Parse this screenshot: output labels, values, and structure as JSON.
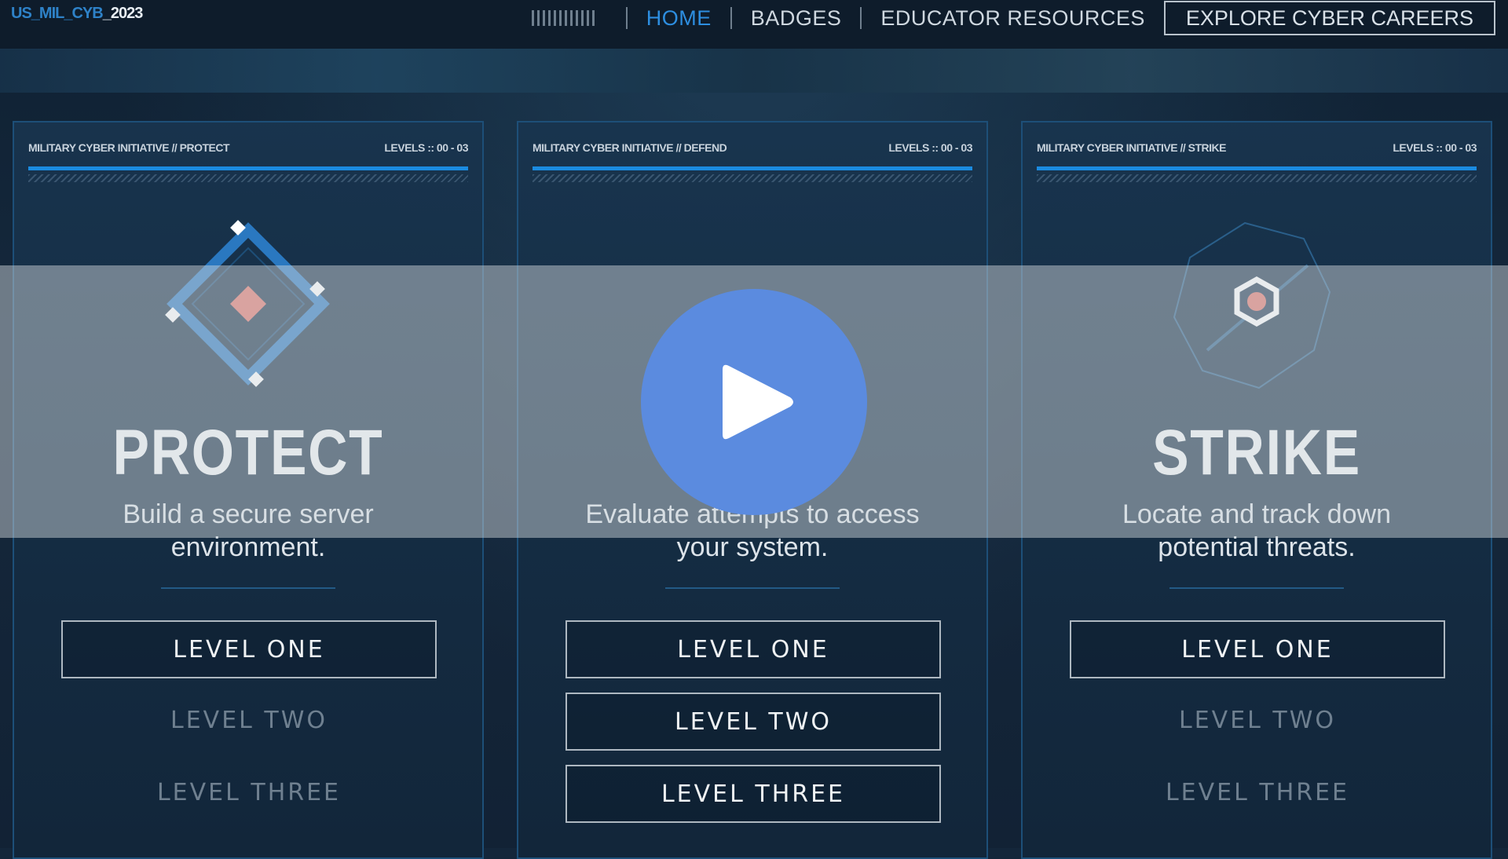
{
  "header": {
    "logo_prefix": "US_MIL_CYB",
    "logo_year": "_2023",
    "nav": [
      "HOME",
      "BADGES",
      "EDUCATOR RESOURCES"
    ],
    "cta": "EXPLORE CYBER CAREERS"
  },
  "cards": [
    {
      "tag": "MILITARY CYBER INITIATIVE // PROTECT",
      "levels_tag": "LEVELS :: 00 - 03",
      "title": "PROTECT",
      "desc": "Build a secure server environment.",
      "icon": "protect-diamond-icon",
      "levels": [
        "LEVEL ONE",
        "LEVEL TWO",
        "LEVEL THREE"
      ],
      "unlocked": [
        true,
        false,
        false
      ]
    },
    {
      "tag": "MILITARY CYBER INITIATIVE // DEFEND",
      "levels_tag": "LEVELS :: 00 - 03",
      "title": "",
      "desc": "Evaluate attempts to access your system.",
      "icon": "defend-icon",
      "levels": [
        "LEVEL ONE",
        "LEVEL TWO",
        "LEVEL THREE"
      ],
      "unlocked": [
        true,
        true,
        true
      ]
    },
    {
      "tag": "MILITARY CYBER INITIATIVE // STRIKE",
      "levels_tag": "LEVELS :: 00 - 03",
      "title": "STRIKE",
      "desc": "Locate and track down potential threats.",
      "icon": "strike-target-icon",
      "levels": [
        "LEVEL ONE",
        "LEVEL TWO",
        "LEVEL THREE"
      ],
      "unlocked": [
        true,
        false,
        false
      ]
    }
  ],
  "overlay": {
    "icon": "play-icon"
  },
  "colors": {
    "accent": "#2d8ee0",
    "play": "#5b8bdf",
    "target_dot": "#e0736a"
  }
}
